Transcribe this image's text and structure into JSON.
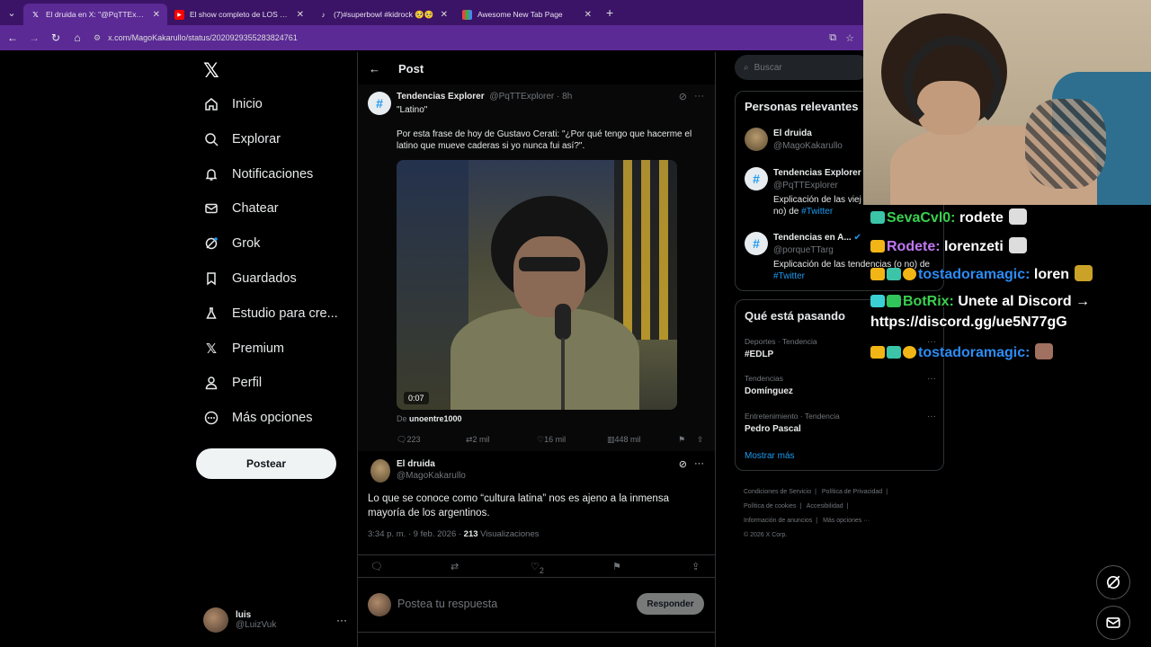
{
  "browser": {
    "tabs": [
      {
        "label": "El druida en X: \"@PqTTExplorer",
        "icon": "x-icon",
        "active": true
      },
      {
        "label": "El show completo de LOS PALMERAS",
        "icon": "youtube-icon",
        "active": false
      },
      {
        "label": "(7)#superbowl #kidrock 🥺🥺",
        "icon": "tiktok-icon",
        "active": false
      },
      {
        "label": "Awesome New Tab Page",
        "icon": "grid-icon",
        "active": false
      }
    ],
    "url": "x.com/MagoKakarullo/status/2020929355283824761"
  },
  "nav": {
    "items": [
      {
        "label": "Inicio",
        "icon": "home-icon"
      },
      {
        "label": "Explorar",
        "icon": "search-icon"
      },
      {
        "label": "Notificaciones",
        "icon": "bell-icon"
      },
      {
        "label": "Chatear",
        "icon": "mail-icon"
      },
      {
        "label": "Grok",
        "icon": "grok-icon"
      },
      {
        "label": "Guardados",
        "icon": "bookmark-icon"
      },
      {
        "label": "Estudio para cre...",
        "icon": "flask-icon"
      },
      {
        "label": "Premium",
        "icon": "x-icon"
      },
      {
        "label": "Perfil",
        "icon": "person-icon"
      },
      {
        "label": "Más opciones",
        "icon": "more-circle-icon"
      }
    ],
    "post_button": "Postear",
    "me_name": "luis",
    "me_handle": "@LuizVuk"
  },
  "main": {
    "header_title": "Post",
    "quoted": {
      "name": "Tendencias Explorer",
      "handle_time": "@PqTTExplorer · 8h",
      "text1": "\"Latino\"",
      "text2": "Por esta frase de hoy de Gustavo Cerati: \"¿Por qué tengo que hacerme el latino que mueve caderas si yo nunca fui así?\".",
      "video_duration": "0:07",
      "from_prefix": "De",
      "from_name": "unoentre1000",
      "replies": "223",
      "reposts": "2 mil",
      "likes": "16 mil",
      "views": "448 mil"
    },
    "tweet": {
      "name": "El druida",
      "handle": "@MagoKakarullo",
      "body": "Lo que se conoce como “cultura latina” nos es ajeno a la inmensa mayoría de los argentinos.",
      "time": "3:34 p. m. · 9 feb. 2026 · ",
      "views_count": "213",
      "views_label": " Visualizaciones",
      "likes": "2"
    },
    "reply_placeholder": "Postea tu respuesta",
    "reply_button": "Responder"
  },
  "sidebar": {
    "search_placeholder": "Buscar",
    "relevant_title": "Personas relevantes",
    "people": [
      {
        "name": "El druida",
        "handle": "@MagoKakarullo",
        "bio": "",
        "bio_link": ""
      },
      {
        "name": "Tendencias Explorer",
        "handle": "@PqTTExplorer",
        "bio": "Explicación de las viej",
        "bio2": "no) de ",
        "bio_link": "#Twitter"
      },
      {
        "name": "Tendencias en A...",
        "handle": "@porqueTTarg",
        "bio": "Explicación de las tendencias (o no) de ",
        "bio_link": "#Twitter"
      }
    ],
    "trends_title": "Qué está pasando",
    "trends": [
      {
        "category": "Deportes · Tendencia",
        "name": "#EDLP"
      },
      {
        "category": "Tendencias",
        "name": "Domínguez"
      },
      {
        "category": "Entretenimiento · Tendencia",
        "name": "Pedro Pascal"
      }
    ],
    "show_more": "Mostrar más",
    "footer": [
      "Condiciones de Servicio",
      "|",
      "Política de Privacidad",
      "|",
      "Política de cookies",
      "|",
      "Accesibilidad",
      "|",
      "Información de anuncios",
      "|",
      "Más opciones ···",
      "© 2026 X Corp."
    ]
  },
  "chat": [
    {
      "user": "SevaCvl0:",
      "text": " rodete",
      "color": "#3ad04f"
    },
    {
      "user": "Rodete:",
      "text": " lorenzeti",
      "color": "#c178f4"
    },
    {
      "user": "tostadoramagic:",
      "text": " loren",
      "color": "#2c8cf5"
    },
    {
      "user": "BotRix:",
      "text": " Unete al Discord →",
      "color": "#3ad04f"
    },
    {
      "user": "",
      "text": "https://discord.gg/ue5N77gG",
      "color": "#ffffff"
    },
    {
      "user": "tostadoramagic:",
      "text": "",
      "color": "#2c8cf5"
    }
  ]
}
